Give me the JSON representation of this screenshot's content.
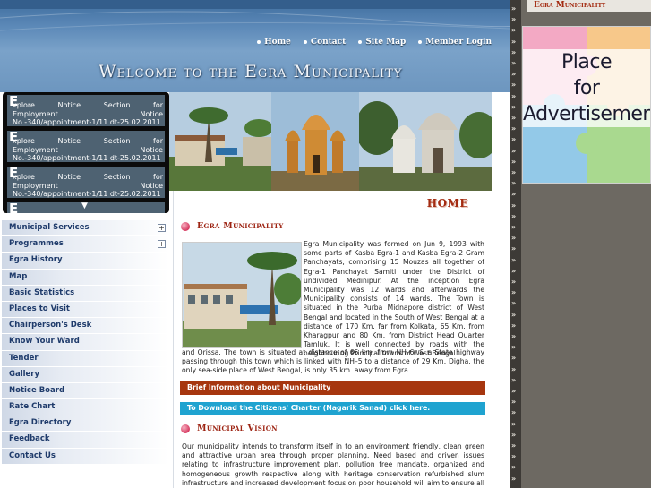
{
  "header": {
    "nav": [
      "Home",
      "Contact",
      "Site Map",
      "Member Login"
    ],
    "welcome": "Welcome to the Egra Municipality"
  },
  "news": {
    "items": [
      {
        "line1": "xplore Notice Section for",
        "line2": "Employment Notice No.-340/appointment-1/11 dt-25.02.2011"
      },
      {
        "line1": "xplore Notice Section for",
        "line2": "Employment Notice No.-340/appointment-1/11 dt-25.02.2011"
      },
      {
        "line1": "xplore Notice Section for",
        "line2": "Employment Notice No.-340/appointment-1/11 dt-25.02.2011"
      }
    ],
    "letter": "E"
  },
  "menu": [
    {
      "label": "Municipal Services",
      "expand": "+"
    },
    {
      "label": "Programmes",
      "expand": "+"
    },
    {
      "label": "Egra History"
    },
    {
      "label": "Map"
    },
    {
      "label": "Basic Statistics"
    },
    {
      "label": "Places to Visit"
    },
    {
      "label": "Chairperson's Desk"
    },
    {
      "label": "Know Your Ward"
    },
    {
      "label": "Tender"
    },
    {
      "label": "Gallery"
    },
    {
      "label": "Notice Board"
    },
    {
      "label": "Rate Chart"
    },
    {
      "label": "Egra Directory"
    },
    {
      "label": "Feedback"
    },
    {
      "label": "Contact Us"
    }
  ],
  "content": {
    "home_label": "HOME",
    "section1_title": "Egra Municipality",
    "intro": "Egra Municipality was formed on Jun 9, 1993 with some parts of Kasba Egra-1 and Kasba Egra-2 Gram Panchayats, comprising 15 Mouzas all together of Egra-1 Panchayat Samiti under the District of undivided Medinipur. At the inception Egra Municipality was 12 wards and afterwards the Municipality consists of 14 wards. The Town is situated in the Purba Midnapore district of West Bengal and located in the South of West Bengal at a distance of 170 Km. far from Kolkata, 65 Km. from Kharagpur and 80 Km. from District Head Quarter Tamluk. It is well connected by roads with the neighbouring Principal towns of West Bengal",
    "intro_cont": "and Orissa. The town is situated at distance of 65 km. from NH–6. & a State highway passing through this town which is linked with NH–5 to a distance of 29 Km. Digha, the only sea-side place of West Bengal, is only 35 km. away from Egra.",
    "bar1": "Brief Information about Municipality",
    "bar2": "To Download the Citizens' Charter (Nagarik Sanad) click here.",
    "section2_title": "Municipal Vision",
    "vision": "Our municipality intends to transform itself in to an environment friendly, clean green and attractive urban area through proper planning. Need based and driven issues relating to infrastructure improvement plan, pollution free mandate, organized and homogeneous growth respective along with heritage conservation refurbished slum infrastructure and increased development focus on poor household will aim to ensure all citizens to lead healthy lives."
  },
  "right": {
    "title": "Egra Municipality",
    "ad_lines": [
      "Place",
      "for",
      "Advertisement"
    ]
  },
  "colors": {
    "menu_text": "#1f3b6b",
    "title_red": "#9d2413",
    "bar1": "#a6360f",
    "bar2": "#1fa3d0"
  }
}
